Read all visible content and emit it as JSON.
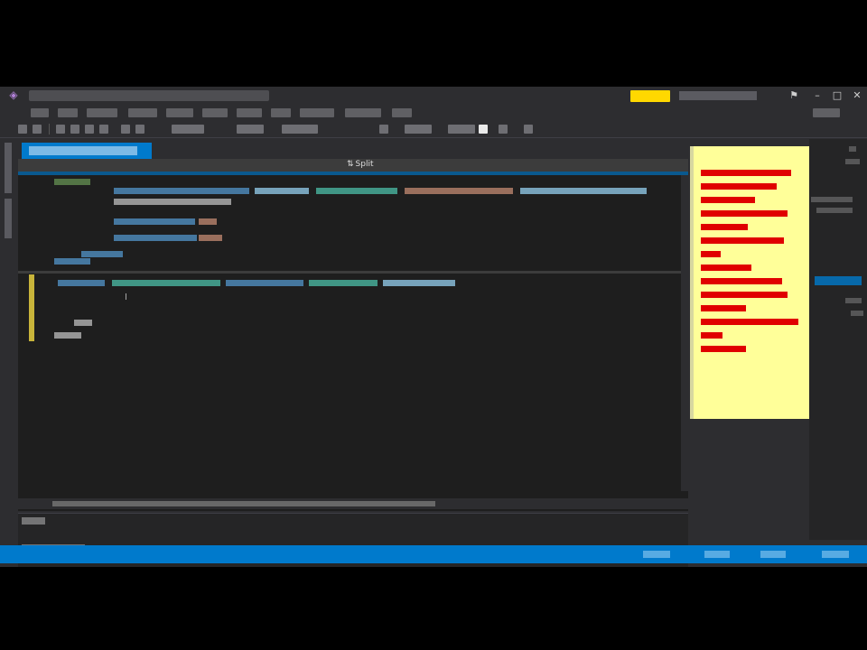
{
  "app": {
    "title": "",
    "notification_color": "#ffd800",
    "accent": "#007acc"
  },
  "menus": [
    "",
    "",
    "",
    "",
    "",
    "",
    "",
    "",
    "",
    "",
    "",
    ""
  ],
  "editor": {
    "active_tab": "",
    "designer_label": "Split",
    "designer_icon": "split-view-icon",
    "theme_background": "#1e1e1e",
    "gutter_color": "#c8b43a"
  },
  "output_panel": {
    "title": "",
    "source_label": ""
  },
  "status_bar": {
    "text": "",
    "color": "#007acc"
  },
  "sticky_note": {
    "background": "#ffff99",
    "text_color": "#e00000",
    "lines": 14
  }
}
